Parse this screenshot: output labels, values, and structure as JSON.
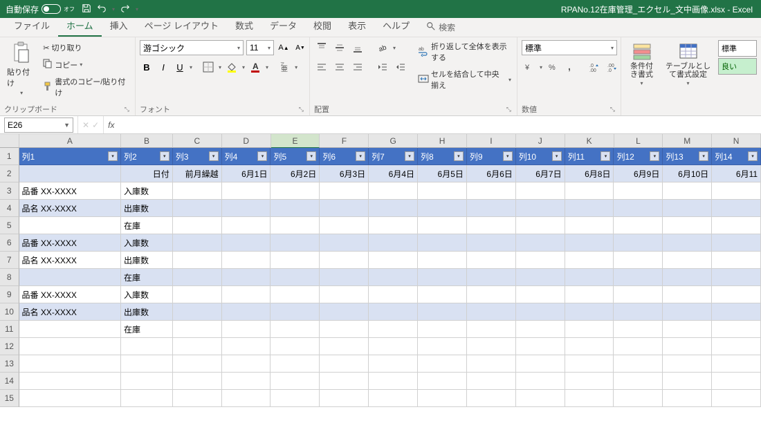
{
  "titlebar": {
    "autosave_label": "自動保存",
    "autosave_state": "オフ",
    "filename": "RPANo.12在庫管理_エクセル_文中画像.xlsx - Excel"
  },
  "tabs": {
    "items": [
      "ファイル",
      "ホーム",
      "挿入",
      "ページ レイアウト",
      "数式",
      "データ",
      "校閲",
      "表示",
      "ヘルプ"
    ],
    "active_index": 1,
    "search_label": "検索"
  },
  "ribbon": {
    "clipboard": {
      "paste": "貼り付け",
      "cut": "切り取り",
      "copy": "コピー",
      "format_painter": "書式のコピー/貼り付け",
      "group_label": "クリップボード"
    },
    "font": {
      "font_name": "游ゴシック",
      "font_size": "11",
      "bold": "B",
      "italic": "I",
      "underline": "U",
      "group_label": "フォント"
    },
    "alignment": {
      "wrap": "折り返して全体を表示する",
      "merge": "セルを結合して中央揃え",
      "group_label": "配置"
    },
    "number": {
      "format": "標準",
      "group_label": "数値"
    },
    "styles": {
      "cond_fmt": "条件付き書式",
      "as_table": "テーブルとして書式設定",
      "normal": "標準",
      "good": "良い"
    }
  },
  "namebox": {
    "ref": "E26"
  },
  "formula": {
    "fx": "fx",
    "value": ""
  },
  "columns": [
    "A",
    "B",
    "C",
    "D",
    "E",
    "F",
    "G",
    "H",
    "I",
    "J",
    "K",
    "L",
    "M",
    "N"
  ],
  "selected_col_index": 4,
  "header_row": [
    "列1",
    "列2",
    "列3",
    "列4",
    "列5",
    "列6",
    "列7",
    "列8",
    "列9",
    "列10",
    "列11",
    "列12",
    "列13",
    "列14"
  ],
  "date_row": [
    "",
    "日付",
    "前月繰越",
    "6月1日",
    "6月2日",
    "6月3日",
    "6月4日",
    "6月5日",
    "6月6日",
    "6月7日",
    "6月8日",
    "6月9日",
    "6月10日",
    "6月11"
  ],
  "data_rows": [
    {
      "n": 3,
      "a": "品番  XX-XXXX",
      "b": "入庫数",
      "band": false
    },
    {
      "n": 4,
      "a": "品名  XX-XXXX",
      "b": "出庫数",
      "band": true
    },
    {
      "n": 5,
      "a": "",
      "b": "在庫",
      "band": false
    },
    {
      "n": 6,
      "a": "品番  XX-XXXX",
      "b": "入庫数",
      "band": true
    },
    {
      "n": 7,
      "a": "品名  XX-XXXX",
      "b": "出庫数",
      "band": false
    },
    {
      "n": 8,
      "a": "",
      "b": "在庫",
      "band": true
    },
    {
      "n": 9,
      "a": "品番  XX-XXXX",
      "b": "入庫数",
      "band": false
    },
    {
      "n": 10,
      "a": "品名  XX-XXXX",
      "b": "出庫数",
      "band": true
    },
    {
      "n": 11,
      "a": "",
      "b": "在庫",
      "band": false
    },
    {
      "n": 12,
      "a": "",
      "b": "",
      "band": false
    },
    {
      "n": 13,
      "a": "",
      "b": "",
      "band": false
    },
    {
      "n": 14,
      "a": "",
      "b": "",
      "band": false
    },
    {
      "n": 15,
      "a": "",
      "b": "",
      "band": false
    }
  ],
  "col_widths": [
    "wA",
    "wB",
    "wC",
    "wD",
    "wE",
    "wOther",
    "wOther",
    "wOther",
    "wOther",
    "wOther",
    "wOther",
    "wOther",
    "wOther",
    "wOther"
  ]
}
